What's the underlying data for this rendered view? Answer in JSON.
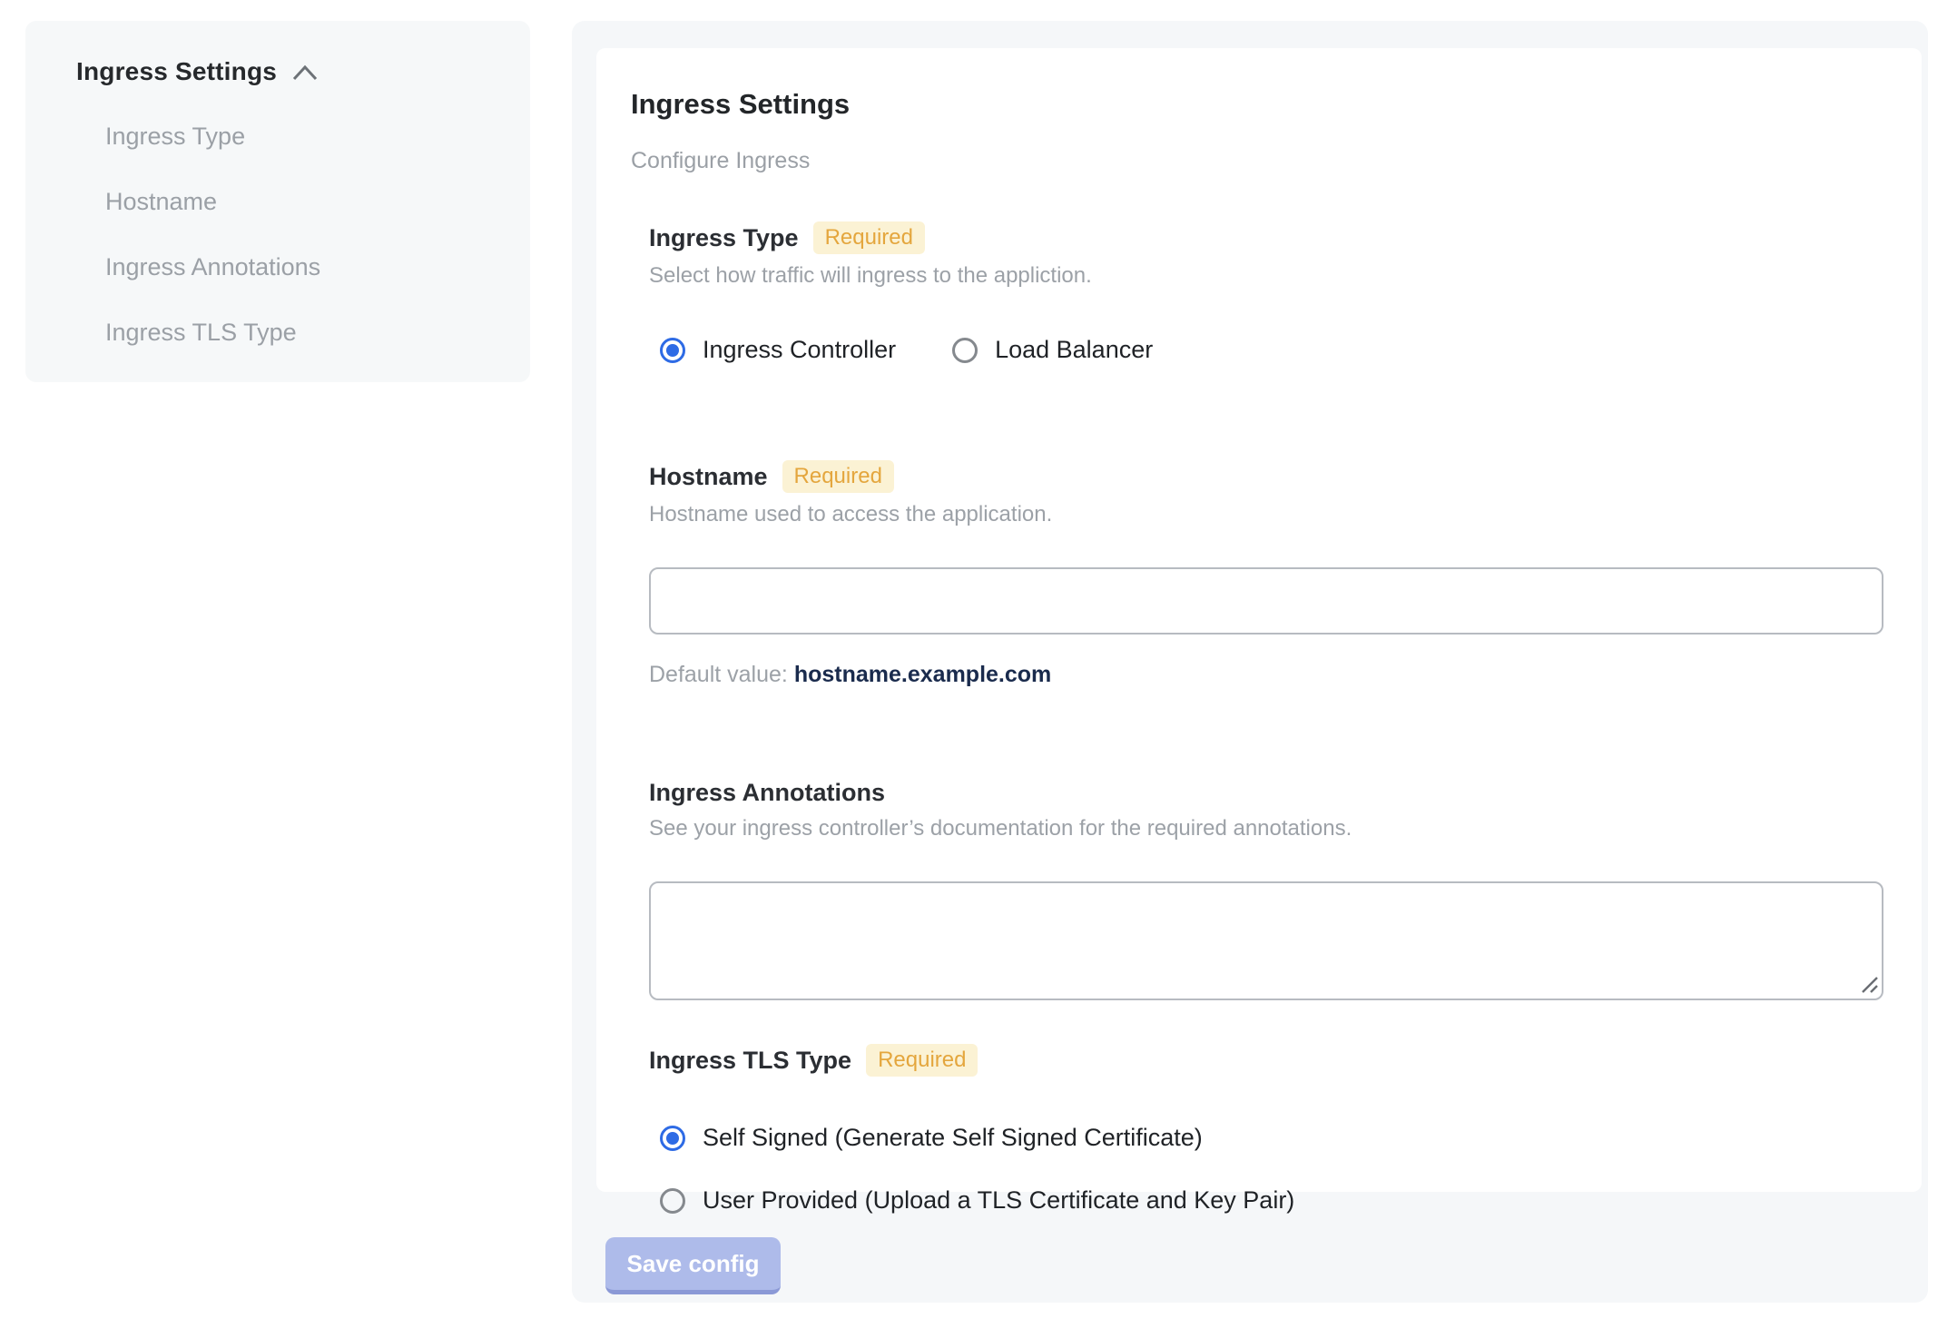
{
  "colors": {
    "accent_blue": "#2e6be5",
    "badge_text": "#e4a63d",
    "badge_bg": "#fbf2d4",
    "save_button_bg": "#aebbea",
    "default_value_text": "#1a2b4d",
    "panel_bg": "#f5f7f9"
  },
  "sidebar": {
    "title": "Ingress Settings",
    "collapse_icon": "chevron-up-icon",
    "items": [
      {
        "label": "Ingress Type"
      },
      {
        "label": "Hostname"
      },
      {
        "label": "Ingress Annotations"
      },
      {
        "label": "Ingress TLS Type"
      }
    ]
  },
  "main": {
    "title": "Ingress Settings",
    "subtitle": "Configure Ingress",
    "required_label": "Required",
    "sections": {
      "ingress_type": {
        "label": "Ingress Type",
        "required": true,
        "description": "Select how traffic will ingress to the appliction.",
        "options": [
          {
            "label": "Ingress Controller",
            "selected": true
          },
          {
            "label": "Load Balancer",
            "selected": false
          }
        ]
      },
      "hostname": {
        "label": "Hostname",
        "required": true,
        "description": "Hostname used to access the application.",
        "input_value": "",
        "default_value_label": "Default value:",
        "default_value": "hostname.example.com"
      },
      "ingress_annotations": {
        "label": "Ingress Annotations",
        "description": "See your ingress controller’s documentation for the required annotations.",
        "textarea_value": ""
      },
      "ingress_tls_type": {
        "label": "Ingress TLS Type",
        "required": true,
        "options": [
          {
            "label": "Self Signed (Generate Self Signed Certificate)",
            "selected": true
          },
          {
            "label": "User Provided (Upload a TLS Certificate and Key Pair)",
            "selected": false
          }
        ]
      }
    },
    "save_button_label": "Save config"
  }
}
